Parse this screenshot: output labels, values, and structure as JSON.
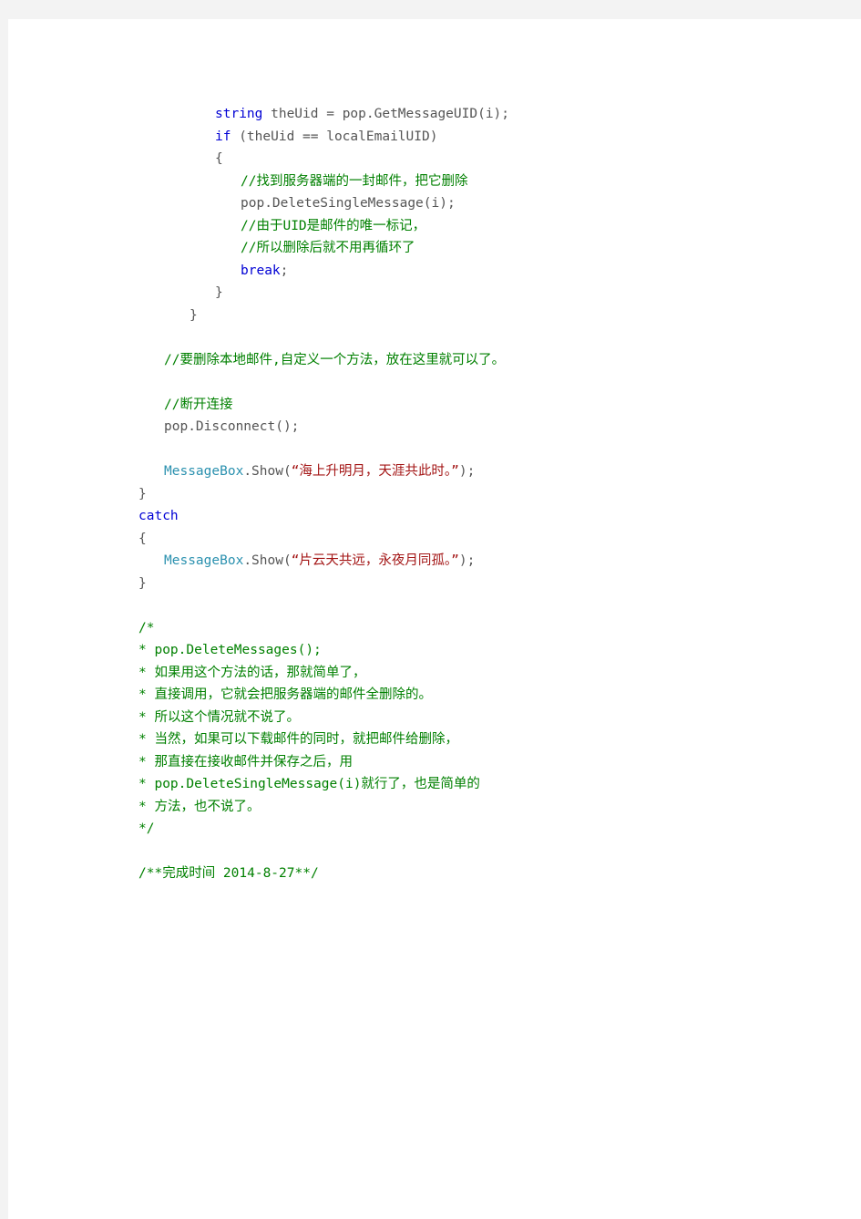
{
  "page": {
    "background": "#f3f3f3",
    "paper": "#ffffff",
    "doc_type": "code-listing"
  },
  "colors": {
    "keyword": "#0000d4",
    "comment": "#008000",
    "type": "#2b91af",
    "string": "#a31515",
    "plain": "#555555"
  },
  "code": {
    "language": "csharp",
    "lines": [
      {
        "indent": 3,
        "parts": [
          {
            "t": "kw",
            "text": "string"
          },
          {
            "t": "pln",
            "text": " theUid = pop.GetMessageUID(i);"
          }
        ]
      },
      {
        "indent": 3,
        "parts": [
          {
            "t": "kw",
            "text": "if"
          },
          {
            "t": "pln",
            "text": " (theUid == localEmailUID)"
          }
        ]
      },
      {
        "indent": 3,
        "parts": [
          {
            "t": "pln",
            "text": "{"
          }
        ]
      },
      {
        "indent": 4,
        "parts": [
          {
            "t": "cmt",
            "text": "//找到服务器端的一封邮件，把它删除"
          }
        ]
      },
      {
        "indent": 4,
        "parts": [
          {
            "t": "pln",
            "text": "pop.DeleteSingleMessage(i);"
          }
        ]
      },
      {
        "indent": 4,
        "parts": [
          {
            "t": "cmt",
            "text": "//由于UID是邮件的唯一标记，"
          }
        ]
      },
      {
        "indent": 4,
        "parts": [
          {
            "t": "cmt",
            "text": "//所以删除后就不用再循环了"
          }
        ]
      },
      {
        "indent": 4,
        "parts": [
          {
            "t": "kw",
            "text": "break"
          },
          {
            "t": "pln",
            "text": ";"
          }
        ]
      },
      {
        "indent": 3,
        "parts": [
          {
            "t": "pln",
            "text": "}"
          }
        ]
      },
      {
        "indent": 2,
        "parts": [
          {
            "t": "pln",
            "text": "}"
          }
        ]
      },
      {
        "indent": 0,
        "parts": []
      },
      {
        "indent": 1,
        "parts": [
          {
            "t": "cmt",
            "text": "//要删除本地邮件,自定义一个方法，放在这里就可以了。"
          }
        ]
      },
      {
        "indent": 0,
        "parts": []
      },
      {
        "indent": 1,
        "parts": [
          {
            "t": "cmt",
            "text": "//断开连接"
          }
        ]
      },
      {
        "indent": 1,
        "parts": [
          {
            "t": "pln",
            "text": "pop.Disconnect();"
          }
        ]
      },
      {
        "indent": 0,
        "parts": []
      },
      {
        "indent": 1,
        "parts": [
          {
            "t": "type",
            "text": "MessageBox"
          },
          {
            "t": "pln",
            "text": ".Show("
          },
          {
            "t": "str",
            "text": "“海上升明月，天涯共此时。”"
          },
          {
            "t": "pln",
            "text": ");"
          }
        ]
      },
      {
        "indent": 0,
        "parts": [
          {
            "t": "pln",
            "text": "}"
          }
        ]
      },
      {
        "indent": 0,
        "parts": [
          {
            "t": "kw",
            "text": "catch"
          }
        ]
      },
      {
        "indent": 0,
        "parts": [
          {
            "t": "pln",
            "text": "{"
          }
        ]
      },
      {
        "indent": 1,
        "parts": [
          {
            "t": "type",
            "text": "MessageBox"
          },
          {
            "t": "pln",
            "text": ".Show("
          },
          {
            "t": "str",
            "text": "“片云天共远，永夜月同孤。”"
          },
          {
            "t": "pln",
            "text": ");"
          }
        ]
      },
      {
        "indent": 0,
        "parts": [
          {
            "t": "pln",
            "text": "}"
          }
        ]
      },
      {
        "indent": 0,
        "parts": []
      },
      {
        "indent": 0,
        "parts": [
          {
            "t": "cmt",
            "text": "/*"
          }
        ]
      },
      {
        "indent": 0,
        "parts": [
          {
            "t": "cmt",
            "text": "* pop.DeleteMessages();"
          }
        ]
      },
      {
        "indent": 0,
        "parts": [
          {
            "t": "cmt",
            "text": "* 如果用这个方法的话，那就简单了，"
          }
        ]
      },
      {
        "indent": 0,
        "parts": [
          {
            "t": "cmt",
            "text": "* 直接调用，它就会把服务器端的邮件全删除的。"
          }
        ]
      },
      {
        "indent": 0,
        "parts": [
          {
            "t": "cmt",
            "text": "* 所以这个情况就不说了。"
          }
        ]
      },
      {
        "indent": 0,
        "parts": [
          {
            "t": "cmt",
            "text": "* 当然，如果可以下载邮件的同时，就把邮件给删除，"
          }
        ]
      },
      {
        "indent": 0,
        "parts": [
          {
            "t": "cmt",
            "text": "* 那直接在接收邮件并保存之后，用"
          }
        ]
      },
      {
        "indent": 0,
        "parts": [
          {
            "t": "cmt",
            "text": "* pop.DeleteSingleMessage(i)就行了，也是简单的"
          }
        ]
      },
      {
        "indent": 0,
        "parts": [
          {
            "t": "cmt",
            "text": "* 方法，也不说了。"
          }
        ]
      },
      {
        "indent": 0,
        "parts": [
          {
            "t": "cmt",
            "text": "*/"
          }
        ]
      },
      {
        "indent": 0,
        "parts": []
      },
      {
        "indent": 0,
        "parts": [
          {
            "t": "cmt",
            "text": "/**完成时间 2014-8-27**/"
          }
        ]
      }
    ]
  }
}
